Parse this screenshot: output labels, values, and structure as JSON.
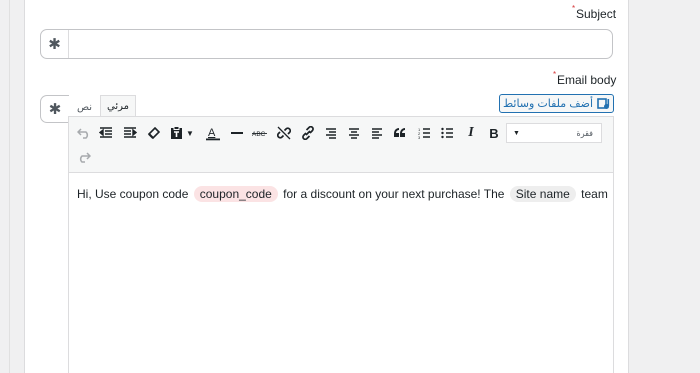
{
  "subject": {
    "label": "Subject",
    "required_mark": "*",
    "merge_tag_icon": "✱"
  },
  "email_body": {
    "label": "Email body",
    "required_mark": "*",
    "merge_tag_icon": "✱",
    "tabs": [
      "مرئي",
      "نص"
    ],
    "add_media_label": "أضف ملفات وسائط",
    "format_select_value": "فقرة",
    "toolbar_icons": [
      "undo-icon",
      "outdent-icon",
      "indent-icon",
      "clear-formatting-icon",
      "paste-as-text-icon",
      "text-color-icon",
      "horizontal-line-icon",
      "strikethrough-icon",
      "unlink-icon",
      "link-icon",
      "align-right-icon",
      "align-center-icon",
      "align-left-icon",
      "blockquote-icon",
      "numbered-list-icon",
      "bulleted-list-icon",
      "italic-icon",
      "bold-icon",
      "redo-icon"
    ],
    "content": {
      "text_1": "Hi, Use coupon code",
      "tag_1": "coupon_code",
      "text_2": "for a discount on your next purchase! The",
      "tag_2": "Site name",
      "text_3": "team"
    }
  },
  "colors": {
    "accent": "#2271b1",
    "required": "#d63638",
    "coupon_tag_bg": "#fbe3e4",
    "site_tag_bg": "#eeeeee"
  }
}
